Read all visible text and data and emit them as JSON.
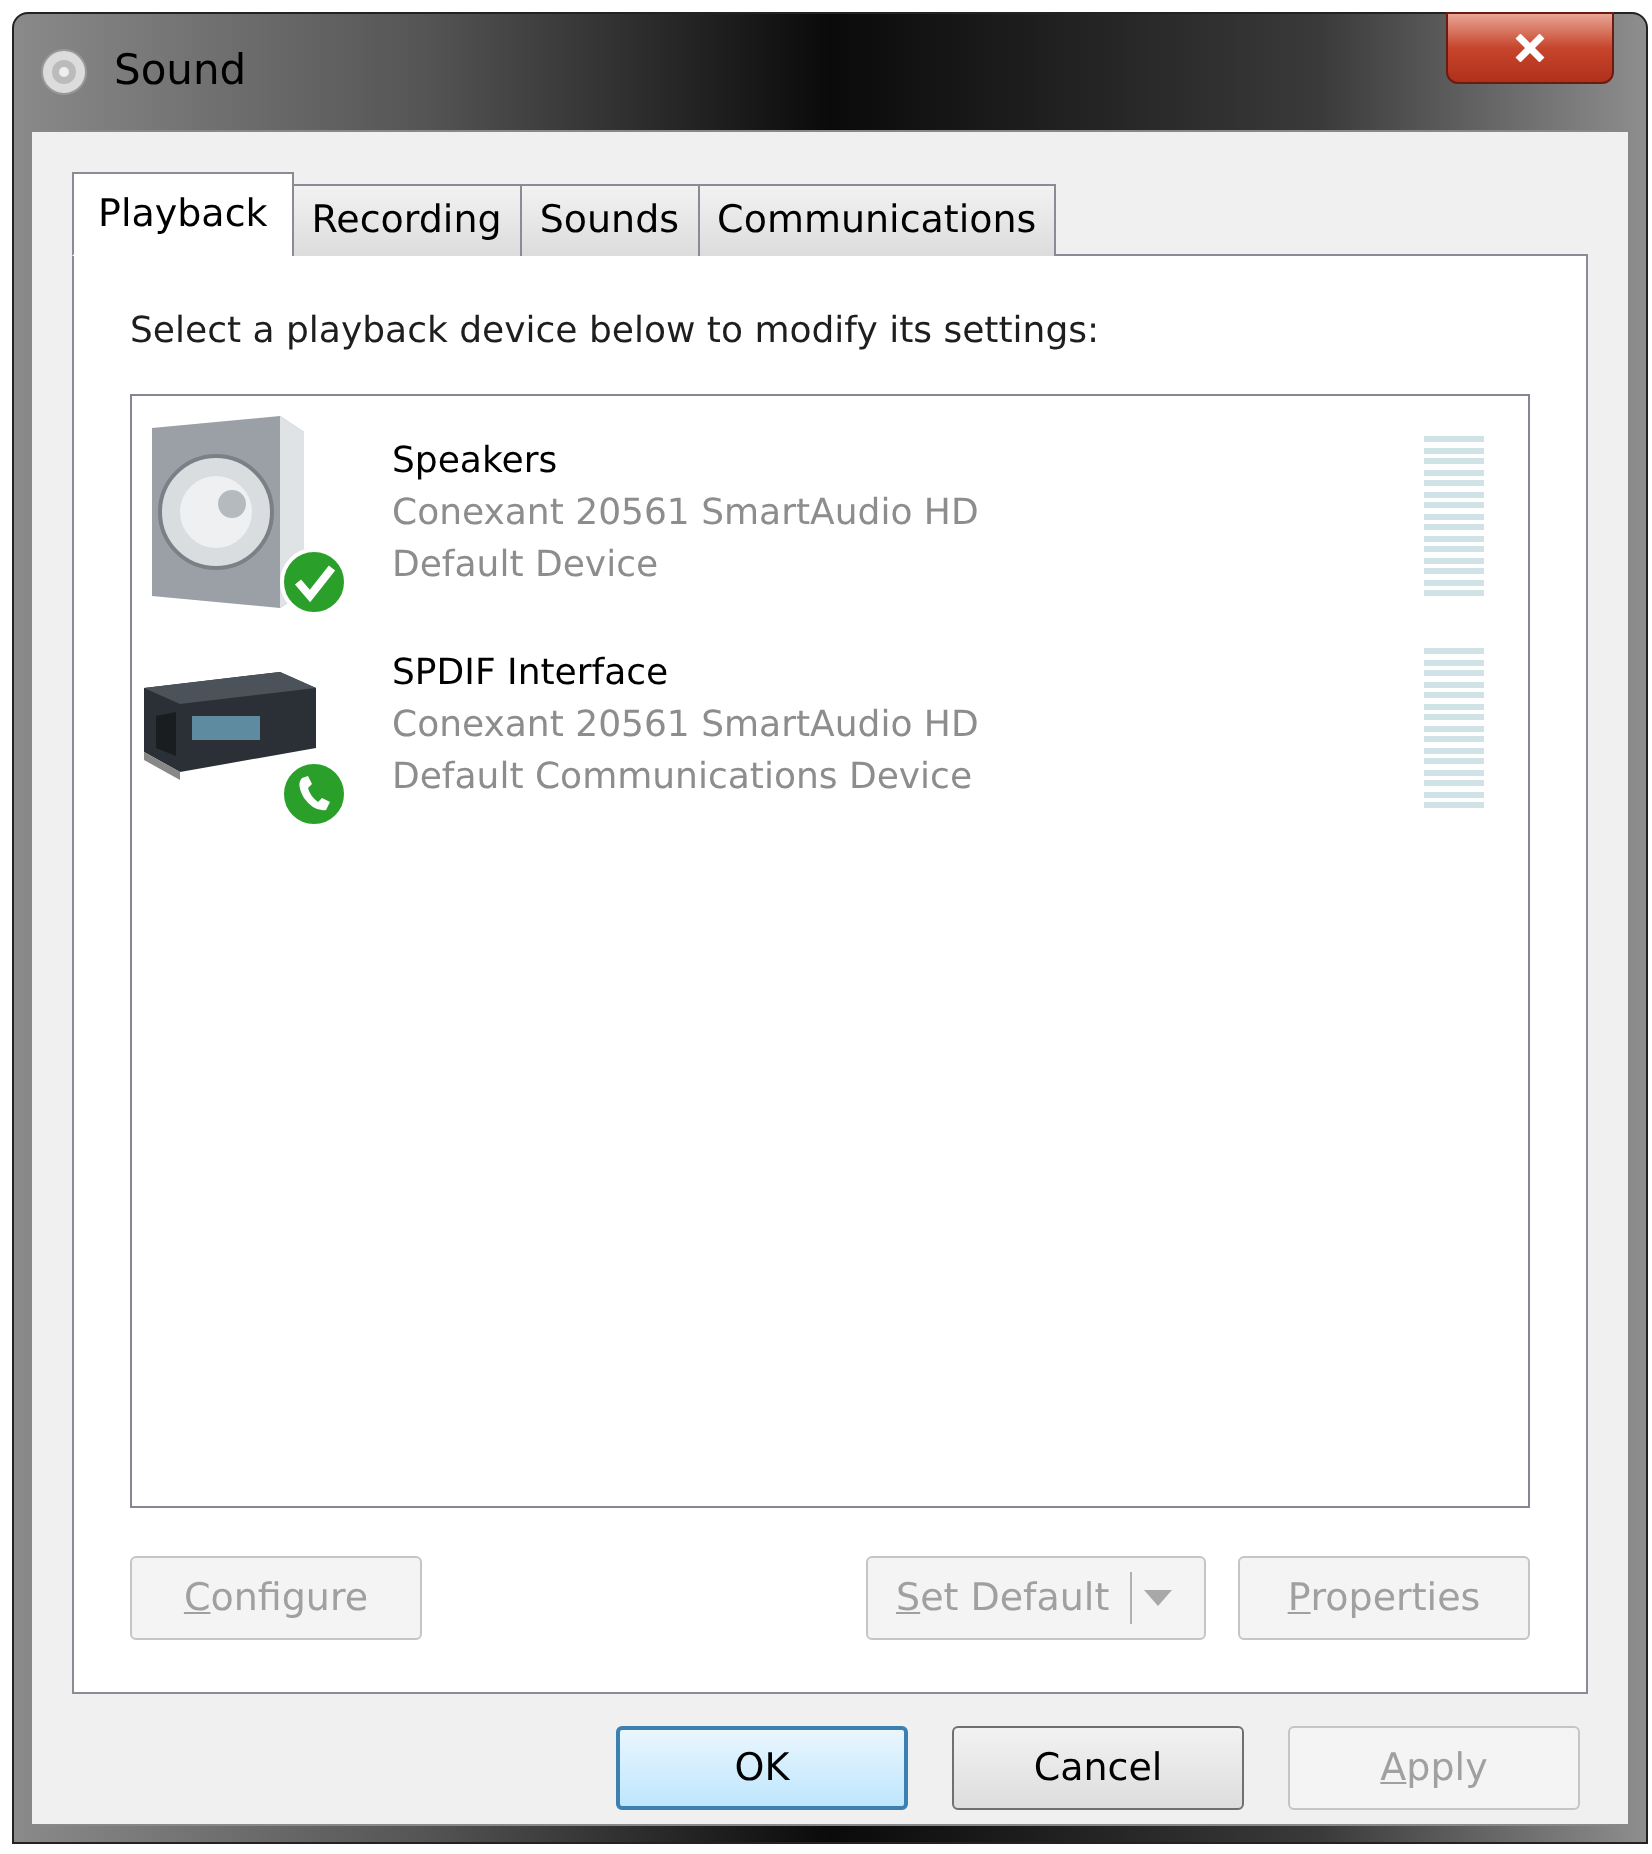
{
  "window": {
    "title": "Sound"
  },
  "tabs": [
    {
      "label": "Playback",
      "selected": true
    },
    {
      "label": "Recording",
      "selected": false
    },
    {
      "label": "Sounds",
      "selected": false
    },
    {
      "label": "Communications",
      "selected": false
    }
  ],
  "instruction": "Select a playback device below to modify its settings:",
  "devices": [
    {
      "kind": "speaker",
      "check_badge": true,
      "phone_badge": false,
      "name": "Speakers",
      "driver": "Conexant 20561 SmartAudio HD",
      "status": "Default Device"
    },
    {
      "kind": "receiver",
      "check_badge": false,
      "phone_badge": true,
      "name": "SPDIF Interface",
      "driver": "Conexant 20561 SmartAudio HD",
      "status": "Default Communications Device"
    }
  ],
  "panel_buttons": [
    {
      "kind": "plain",
      "label": "Configure",
      "disabled": true,
      "mnemonic_first": true
    },
    {
      "kind": "split",
      "label": "Set Default",
      "disabled": true,
      "mnemonic_first": true
    },
    {
      "kind": "plain",
      "label": "Properties",
      "disabled": true,
      "mnemonic_first": true
    }
  ],
  "dialog_buttons": [
    {
      "label": "OK",
      "disabled": false,
      "default": true,
      "mnemonic_first": false
    },
    {
      "label": "Cancel",
      "disabled": false,
      "default": false,
      "mnemonic_first": false
    },
    {
      "label": "Apply",
      "disabled": true,
      "default": false,
      "mnemonic_first": true
    }
  ]
}
